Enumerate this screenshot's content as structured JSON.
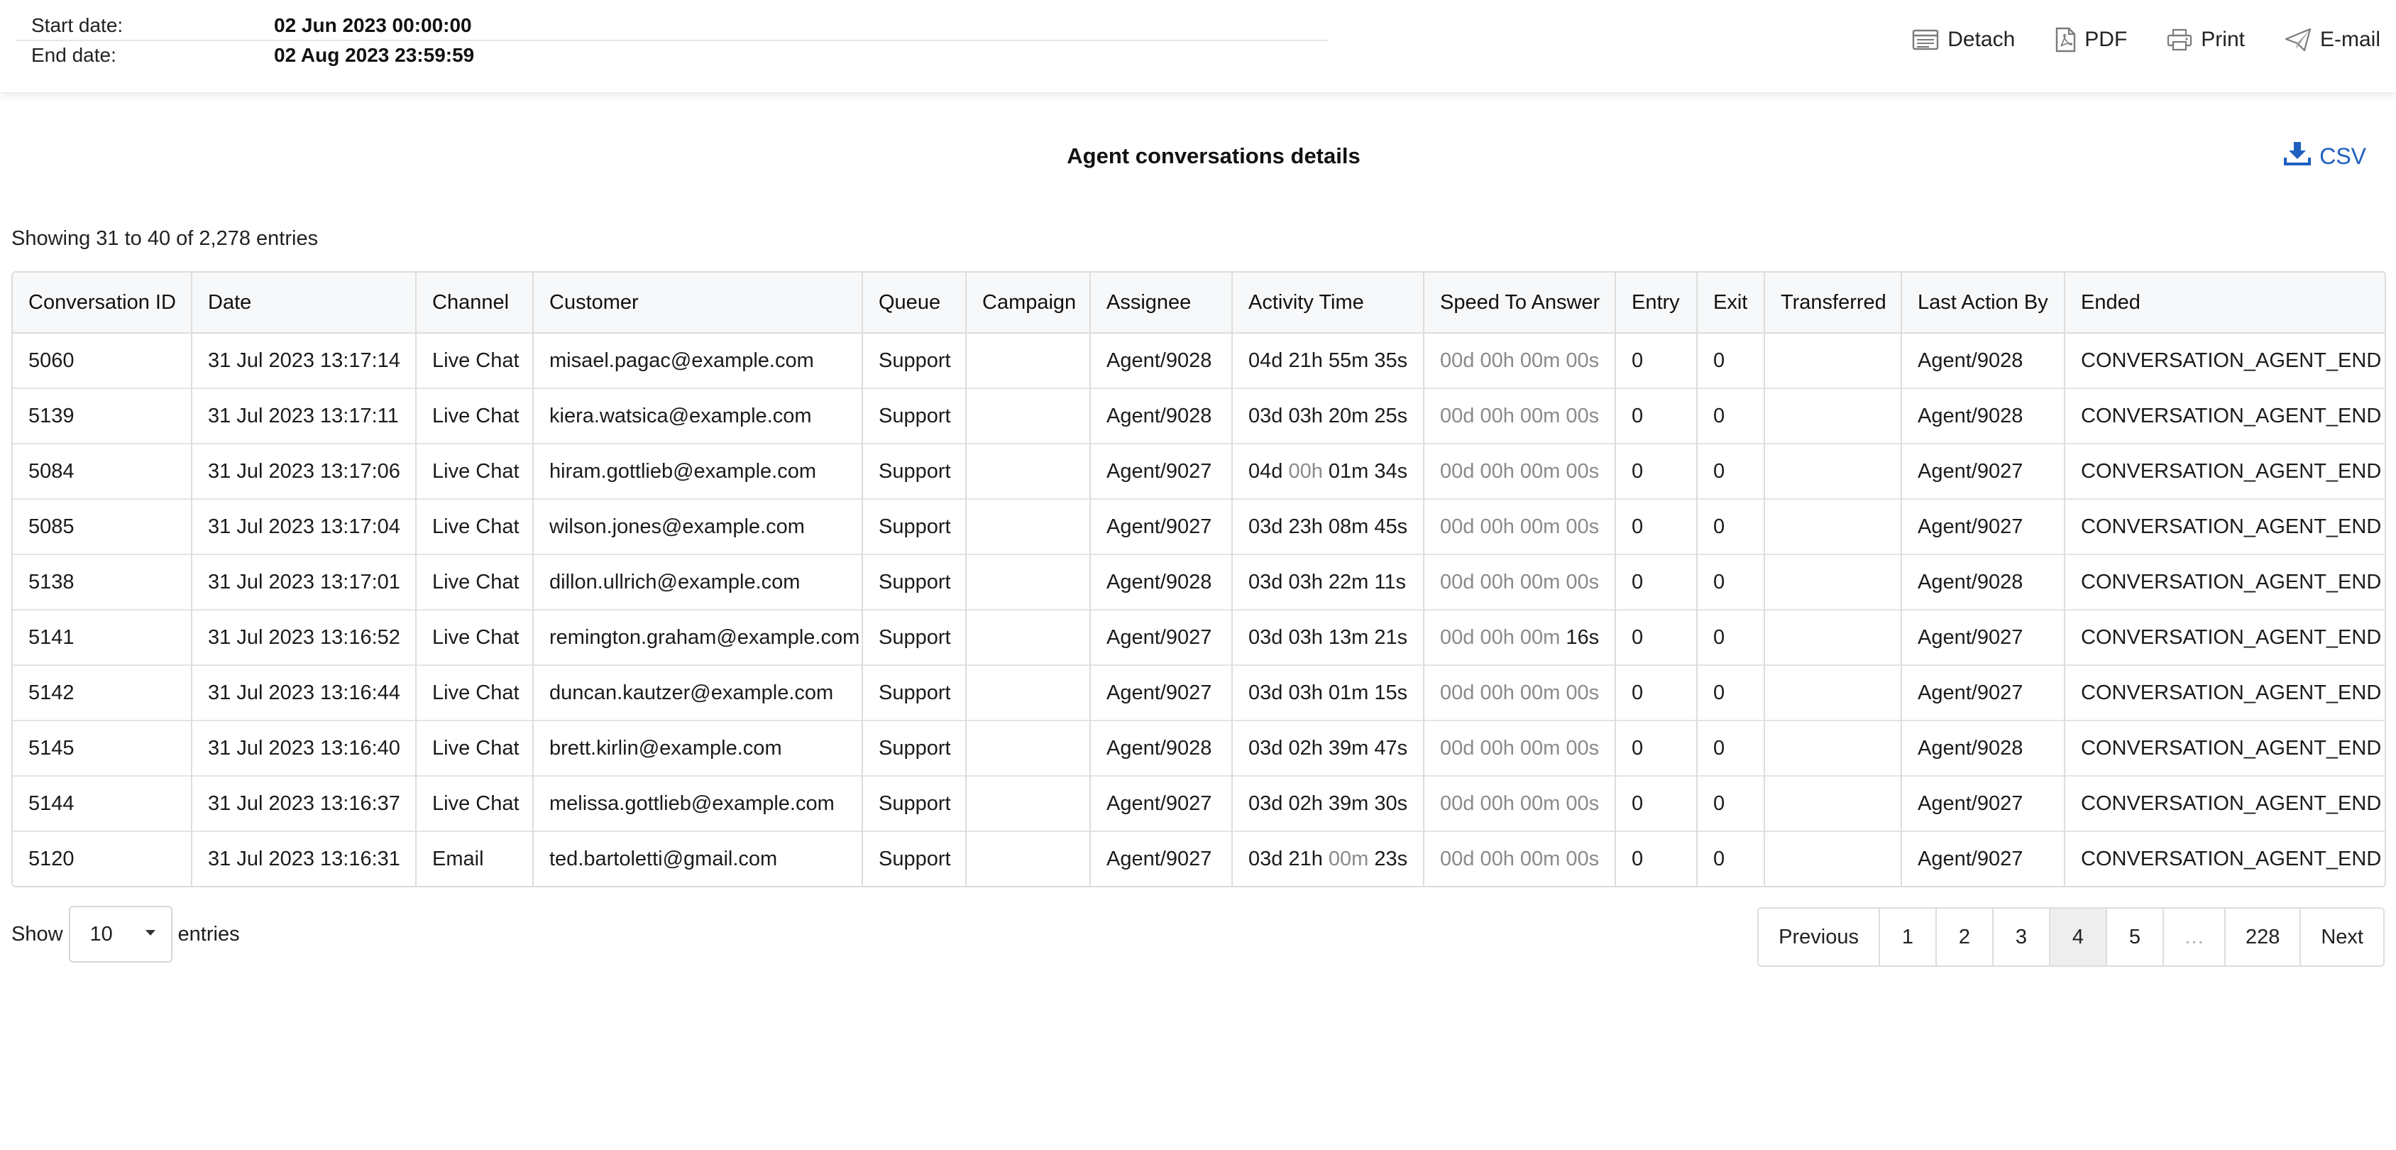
{
  "header": {
    "start_label": "Start date:",
    "start_value": "02 Jun 2023 00:00:00",
    "end_label": "End date:",
    "end_value": "02 Aug 2023 23:59:59",
    "actions": {
      "detach": "Detach",
      "pdf": "PDF",
      "print": "Print",
      "email": "E-mail"
    }
  },
  "report": {
    "title": "Agent conversations details",
    "csv_label": "CSV",
    "info": "Showing 31 to 40 of 2,278 entries"
  },
  "table": {
    "columns": [
      "Conversation ID",
      "Date",
      "Channel",
      "Customer",
      "Queue",
      "Campaign",
      "Assignee",
      "Activity Time",
      "Speed To Answer",
      "Entry",
      "Exit",
      "Transferred",
      "Last Action By",
      "Ended"
    ],
    "rows": [
      {
        "id": "5060",
        "date": "31 Jul 2023 13:17:14",
        "channel": "Live Chat",
        "customer": "misael.pagac@example.com",
        "queue": "Support",
        "campaign": "",
        "assignee": "Agent/9028",
        "activity": [
          "04d",
          "21h",
          "55m",
          "35s"
        ],
        "activity_dim": [
          false,
          false,
          false,
          false
        ],
        "speed": [
          "00d",
          "00h",
          "00m",
          "00s"
        ],
        "speed_dim": [
          true,
          true,
          true,
          true
        ],
        "entry": "0",
        "exit": "0",
        "transferred": "",
        "last_action_by": "Agent/9028",
        "ended": "CONVERSATION_AGENT_END"
      },
      {
        "id": "5139",
        "date": "31 Jul 2023 13:17:11",
        "channel": "Live Chat",
        "customer": "kiera.watsica@example.com",
        "queue": "Support",
        "campaign": "",
        "assignee": "Agent/9028",
        "activity": [
          "03d",
          "03h",
          "20m",
          "25s"
        ],
        "activity_dim": [
          false,
          false,
          false,
          false
        ],
        "speed": [
          "00d",
          "00h",
          "00m",
          "00s"
        ],
        "speed_dim": [
          true,
          true,
          true,
          true
        ],
        "entry": "0",
        "exit": "0",
        "transferred": "",
        "last_action_by": "Agent/9028",
        "ended": "CONVERSATION_AGENT_END"
      },
      {
        "id": "5084",
        "date": "31 Jul 2023 13:17:06",
        "channel": "Live Chat",
        "customer": "hiram.gottlieb@example.com",
        "queue": "Support",
        "campaign": "",
        "assignee": "Agent/9027",
        "activity": [
          "04d",
          "00h",
          "01m",
          "34s"
        ],
        "activity_dim": [
          false,
          true,
          false,
          false
        ],
        "speed": [
          "00d",
          "00h",
          "00m",
          "00s"
        ],
        "speed_dim": [
          true,
          true,
          true,
          true
        ],
        "entry": "0",
        "exit": "0",
        "transferred": "",
        "last_action_by": "Agent/9027",
        "ended": "CONVERSATION_AGENT_END"
      },
      {
        "id": "5085",
        "date": "31 Jul 2023 13:17:04",
        "channel": "Live Chat",
        "customer": "wilson.jones@example.com",
        "queue": "Support",
        "campaign": "",
        "assignee": "Agent/9027",
        "activity": [
          "03d",
          "23h",
          "08m",
          "45s"
        ],
        "activity_dim": [
          false,
          false,
          false,
          false
        ],
        "speed": [
          "00d",
          "00h",
          "00m",
          "00s"
        ],
        "speed_dim": [
          true,
          true,
          true,
          true
        ],
        "entry": "0",
        "exit": "0",
        "transferred": "",
        "last_action_by": "Agent/9027",
        "ended": "CONVERSATION_AGENT_END"
      },
      {
        "id": "5138",
        "date": "31 Jul 2023 13:17:01",
        "channel": "Live Chat",
        "customer": "dillon.ullrich@example.com",
        "queue": "Support",
        "campaign": "",
        "assignee": "Agent/9028",
        "activity": [
          "03d",
          "03h",
          "22m",
          "11s"
        ],
        "activity_dim": [
          false,
          false,
          false,
          false
        ],
        "speed": [
          "00d",
          "00h",
          "00m",
          "00s"
        ],
        "speed_dim": [
          true,
          true,
          true,
          true
        ],
        "entry": "0",
        "exit": "0",
        "transferred": "",
        "last_action_by": "Agent/9028",
        "ended": "CONVERSATION_AGENT_END"
      },
      {
        "id": "5141",
        "date": "31 Jul 2023 13:16:52",
        "channel": "Live Chat",
        "customer": "remington.graham@example.com",
        "queue": "Support",
        "campaign": "",
        "assignee": "Agent/9027",
        "activity": [
          "03d",
          "03h",
          "13m",
          "21s"
        ],
        "activity_dim": [
          false,
          false,
          false,
          false
        ],
        "speed": [
          "00d",
          "00h",
          "00m",
          "16s"
        ],
        "speed_dim": [
          true,
          true,
          true,
          false
        ],
        "entry": "0",
        "exit": "0",
        "transferred": "",
        "last_action_by": "Agent/9027",
        "ended": "CONVERSATION_AGENT_END"
      },
      {
        "id": "5142",
        "date": "31 Jul 2023 13:16:44",
        "channel": "Live Chat",
        "customer": "duncan.kautzer@example.com",
        "queue": "Support",
        "campaign": "",
        "assignee": "Agent/9027",
        "activity": [
          "03d",
          "03h",
          "01m",
          "15s"
        ],
        "activity_dim": [
          false,
          false,
          false,
          false
        ],
        "speed": [
          "00d",
          "00h",
          "00m",
          "00s"
        ],
        "speed_dim": [
          true,
          true,
          true,
          true
        ],
        "entry": "0",
        "exit": "0",
        "transferred": "",
        "last_action_by": "Agent/9027",
        "ended": "CONVERSATION_AGENT_END"
      },
      {
        "id": "5145",
        "date": "31 Jul 2023 13:16:40",
        "channel": "Live Chat",
        "customer": "brett.kirlin@example.com",
        "queue": "Support",
        "campaign": "",
        "assignee": "Agent/9028",
        "activity": [
          "03d",
          "02h",
          "39m",
          "47s"
        ],
        "activity_dim": [
          false,
          false,
          false,
          false
        ],
        "speed": [
          "00d",
          "00h",
          "00m",
          "00s"
        ],
        "speed_dim": [
          true,
          true,
          true,
          true
        ],
        "entry": "0",
        "exit": "0",
        "transferred": "",
        "last_action_by": "Agent/9028",
        "ended": "CONVERSATION_AGENT_END"
      },
      {
        "id": "5144",
        "date": "31 Jul 2023 13:16:37",
        "channel": "Live Chat",
        "customer": "melissa.gottlieb@example.com",
        "queue": "Support",
        "campaign": "",
        "assignee": "Agent/9027",
        "activity": [
          "03d",
          "02h",
          "39m",
          "30s"
        ],
        "activity_dim": [
          false,
          false,
          false,
          false
        ],
        "speed": [
          "00d",
          "00h",
          "00m",
          "00s"
        ],
        "speed_dim": [
          true,
          true,
          true,
          true
        ],
        "entry": "0",
        "exit": "0",
        "transferred": "",
        "last_action_by": "Agent/9027",
        "ended": "CONVERSATION_AGENT_END"
      },
      {
        "id": "5120",
        "date": "31 Jul 2023 13:16:31",
        "channel": "Email",
        "customer": "ted.bartoletti@gmail.com",
        "queue": "Support",
        "campaign": "",
        "assignee": "Agent/9027",
        "activity": [
          "03d",
          "21h",
          "00m",
          "23s"
        ],
        "activity_dim": [
          false,
          false,
          true,
          false
        ],
        "speed": [
          "00d",
          "00h",
          "00m",
          "00s"
        ],
        "speed_dim": [
          true,
          true,
          true,
          true
        ],
        "entry": "0",
        "exit": "0",
        "transferred": "",
        "last_action_by": "Agent/9027",
        "ended": "CONVERSATION_AGENT_END"
      }
    ]
  },
  "footer": {
    "show_label": "Show",
    "page_length": "10",
    "entries_label": "entries",
    "pagination": [
      "Previous",
      "1",
      "2",
      "3",
      "4",
      "5",
      "…",
      "228",
      "Next"
    ],
    "current_page": "4"
  },
  "colors": {
    "accent": "#1f5fbf",
    "dim_text": "#8a8a8a",
    "border": "#dddddd"
  }
}
